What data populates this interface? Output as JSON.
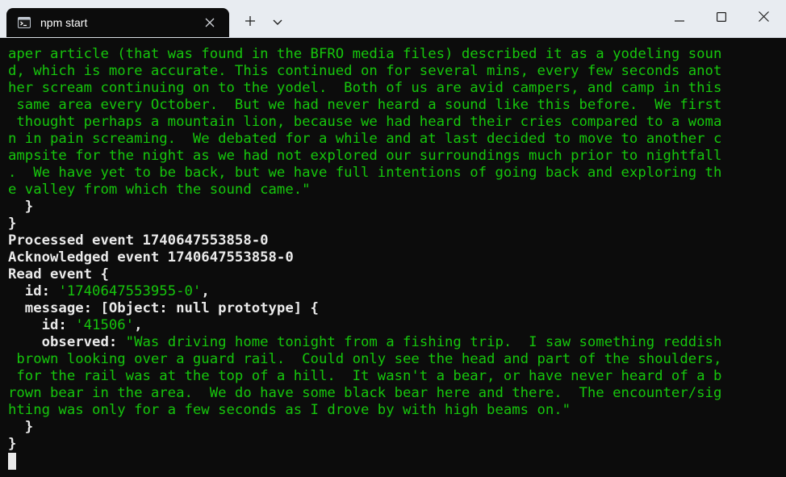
{
  "window": {
    "tab_title": "npm start",
    "icons": {
      "tab": "terminal-icon",
      "tab_close": "close-icon",
      "new_tab": "plus-icon",
      "dropdown": "chevron-down-icon",
      "minimize": "minimize-icon",
      "maximize": "maximize-icon",
      "close": "close-icon"
    }
  },
  "colors": {
    "terminal_bg": "#0c0c0c",
    "string_green": "#16c60c",
    "text_white": "#eaeaea"
  },
  "terminal": {
    "lines": [
      {
        "s": [
          {
            "t": "aper article (that was found in the BFRO media files) described it as a yodeling soun",
            "c": "g"
          }
        ]
      },
      {
        "s": [
          {
            "t": "d, which is more accurate. This continued on for several mins, every few seconds anot",
            "c": "g"
          }
        ]
      },
      {
        "s": [
          {
            "t": "her scream continuing on to the yodel.  Both of us are avid campers, and camp in this",
            "c": "g"
          }
        ]
      },
      {
        "s": [
          {
            "t": " same area every October.  But we had never heard a sound like this before.  We first",
            "c": "g"
          }
        ]
      },
      {
        "s": [
          {
            "t": " thought perhaps a mountain lion, because we had heard their cries compared to a woma",
            "c": "g"
          }
        ]
      },
      {
        "s": [
          {
            "t": "n in pain screaming.  We debated for a while and at last decided to move to another c",
            "c": "g"
          }
        ]
      },
      {
        "s": [
          {
            "t": "ampsite for the night as we had not explored our surroundings much prior to nightfall",
            "c": "g"
          }
        ]
      },
      {
        "s": [
          {
            "t": ".  We have yet to be back, but we have full intentions of going back and exploring th",
            "c": "g"
          }
        ]
      },
      {
        "s": [
          {
            "t": "e valley from which the sound came.\"",
            "c": "g"
          }
        ]
      },
      {
        "s": [
          {
            "t": "  }",
            "c": "w"
          }
        ]
      },
      {
        "s": [
          {
            "t": "}",
            "c": "w"
          }
        ]
      },
      {
        "s": [
          {
            "t": "Processed event 1740647553858-0",
            "c": "w"
          }
        ]
      },
      {
        "s": [
          {
            "t": "Acknowledged event 1740647553858-0",
            "c": "w"
          }
        ]
      },
      {
        "s": [
          {
            "t": "Read event {",
            "c": "w"
          }
        ]
      },
      {
        "s": [
          {
            "t": "  id: ",
            "c": "w"
          },
          {
            "t": "'1740647553955-0'",
            "c": "g"
          },
          {
            "t": ",",
            "c": "w"
          }
        ]
      },
      {
        "s": [
          {
            "t": "  message: [Object: null prototype] {",
            "c": "w"
          }
        ]
      },
      {
        "s": [
          {
            "t": "    id: ",
            "c": "w"
          },
          {
            "t": "'41506'",
            "c": "g"
          },
          {
            "t": ",",
            "c": "w"
          }
        ]
      },
      {
        "s": [
          {
            "t": "    observed: ",
            "c": "w"
          },
          {
            "t": "\"Was driving home tonight from a fishing trip.  I saw something reddish",
            "c": "g"
          }
        ]
      },
      {
        "s": [
          {
            "t": " brown looking over a guard rail.  Could only see the head and part of the shoulders,",
            "c": "g"
          }
        ]
      },
      {
        "s": [
          {
            "t": " for the rail was at the top of a hill.  It wasn't a bear, or have never heard of a b",
            "c": "g"
          }
        ]
      },
      {
        "s": [
          {
            "t": "rown bear in the area.  We do have some black bear here and there.  The encounter/sig",
            "c": "g"
          }
        ]
      },
      {
        "s": [
          {
            "t": "hting was only for a few seconds as I drove by with high beams on.\"",
            "c": "g"
          }
        ]
      },
      {
        "s": [
          {
            "t": "  }",
            "c": "w"
          }
        ]
      },
      {
        "s": [
          {
            "t": "}",
            "c": "w"
          }
        ]
      }
    ]
  }
}
